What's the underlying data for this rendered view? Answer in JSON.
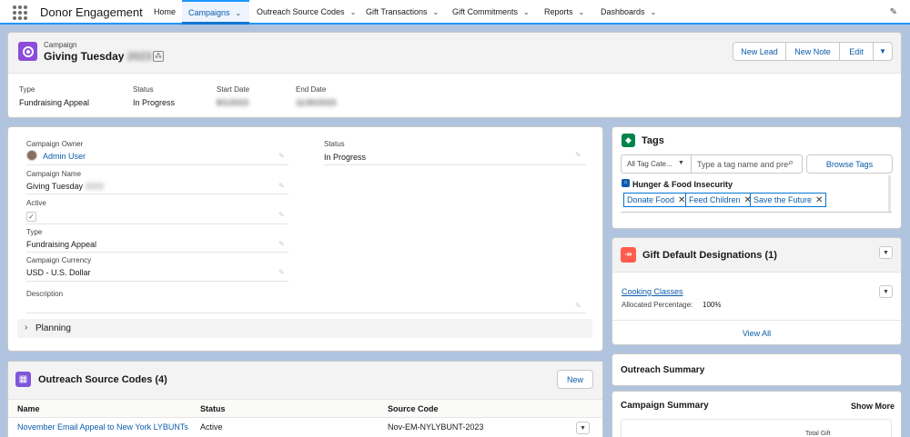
{
  "nav": {
    "app_name": "Donor Engagement",
    "items": [
      {
        "label": "Home"
      },
      {
        "label": "Campaigns"
      },
      {
        "label": "Outreach Source Codes"
      },
      {
        "label": "Gift Transactions"
      },
      {
        "label": "Gift Commitments"
      },
      {
        "label": "Reports"
      },
      {
        "label": "Dashboards"
      }
    ]
  },
  "header": {
    "object_label": "Campaign",
    "title": "Giving Tuesday",
    "title_year": "2023",
    "buttons": {
      "new_lead": "New Lead",
      "new_note": "New Note",
      "edit": "Edit"
    },
    "fields": [
      {
        "label": "Type",
        "value": "Fundraising Appeal"
      },
      {
        "label": "Status",
        "value": "In Progress"
      },
      {
        "label": "Start Date",
        "value": "8/1/2023"
      },
      {
        "label": "End Date",
        "value": "11/30/2023"
      }
    ]
  },
  "details": {
    "owner_label": "Campaign Owner",
    "owner_value": "Admin User",
    "status_label": "Status",
    "status_value": "In Progress",
    "name_label": "Campaign Name",
    "name_value": "Giving Tuesday",
    "name_year": "2023",
    "active_label": "Active",
    "active_check": "✓",
    "type_label": "Type",
    "type_value": "Fundraising Appeal",
    "currency_label": "Campaign Currency",
    "currency_value": "USD - U.S. Dollar",
    "description_label": "Description",
    "planning_label": "Planning"
  },
  "outreach": {
    "title": "Outreach Source Codes (4)",
    "new_label": "New",
    "columns": [
      "Name",
      "Status",
      "Source Code"
    ],
    "rows": [
      {
        "name": "November Email Appeal to New York LYBUNTs",
        "status": "Active",
        "code": "Nov-EM-NYLYBUNT-2023"
      }
    ]
  },
  "tags": {
    "title": "Tags",
    "category_select": "All Tag Cate...",
    "input_placeholder": "Type a tag name and pre",
    "browse_label": "Browse Tags",
    "group_name": "Hunger & Food Insecurity",
    "items": [
      "Donate Food",
      "Feed Children",
      "Save the Future"
    ]
  },
  "gift_designations": {
    "title": "Gift Default Designations (1)",
    "item_name": "Cooking Classes",
    "alloc_label": "Allocated Percentage:",
    "alloc_value": "100%",
    "view_all": "View All"
  },
  "summaries": {
    "outreach_summary": "Outreach Summary",
    "campaign_summary": "Campaign Summary",
    "show_more": "Show More",
    "total_gift": "Total Gift"
  },
  "colors": {
    "brand": "#0176d3",
    "campaign_icon": "#8d4bd9",
    "tags_icon": "#04844b",
    "gift_icon": "#fe5c4c",
    "outreach_icon": "#7f56d9"
  }
}
